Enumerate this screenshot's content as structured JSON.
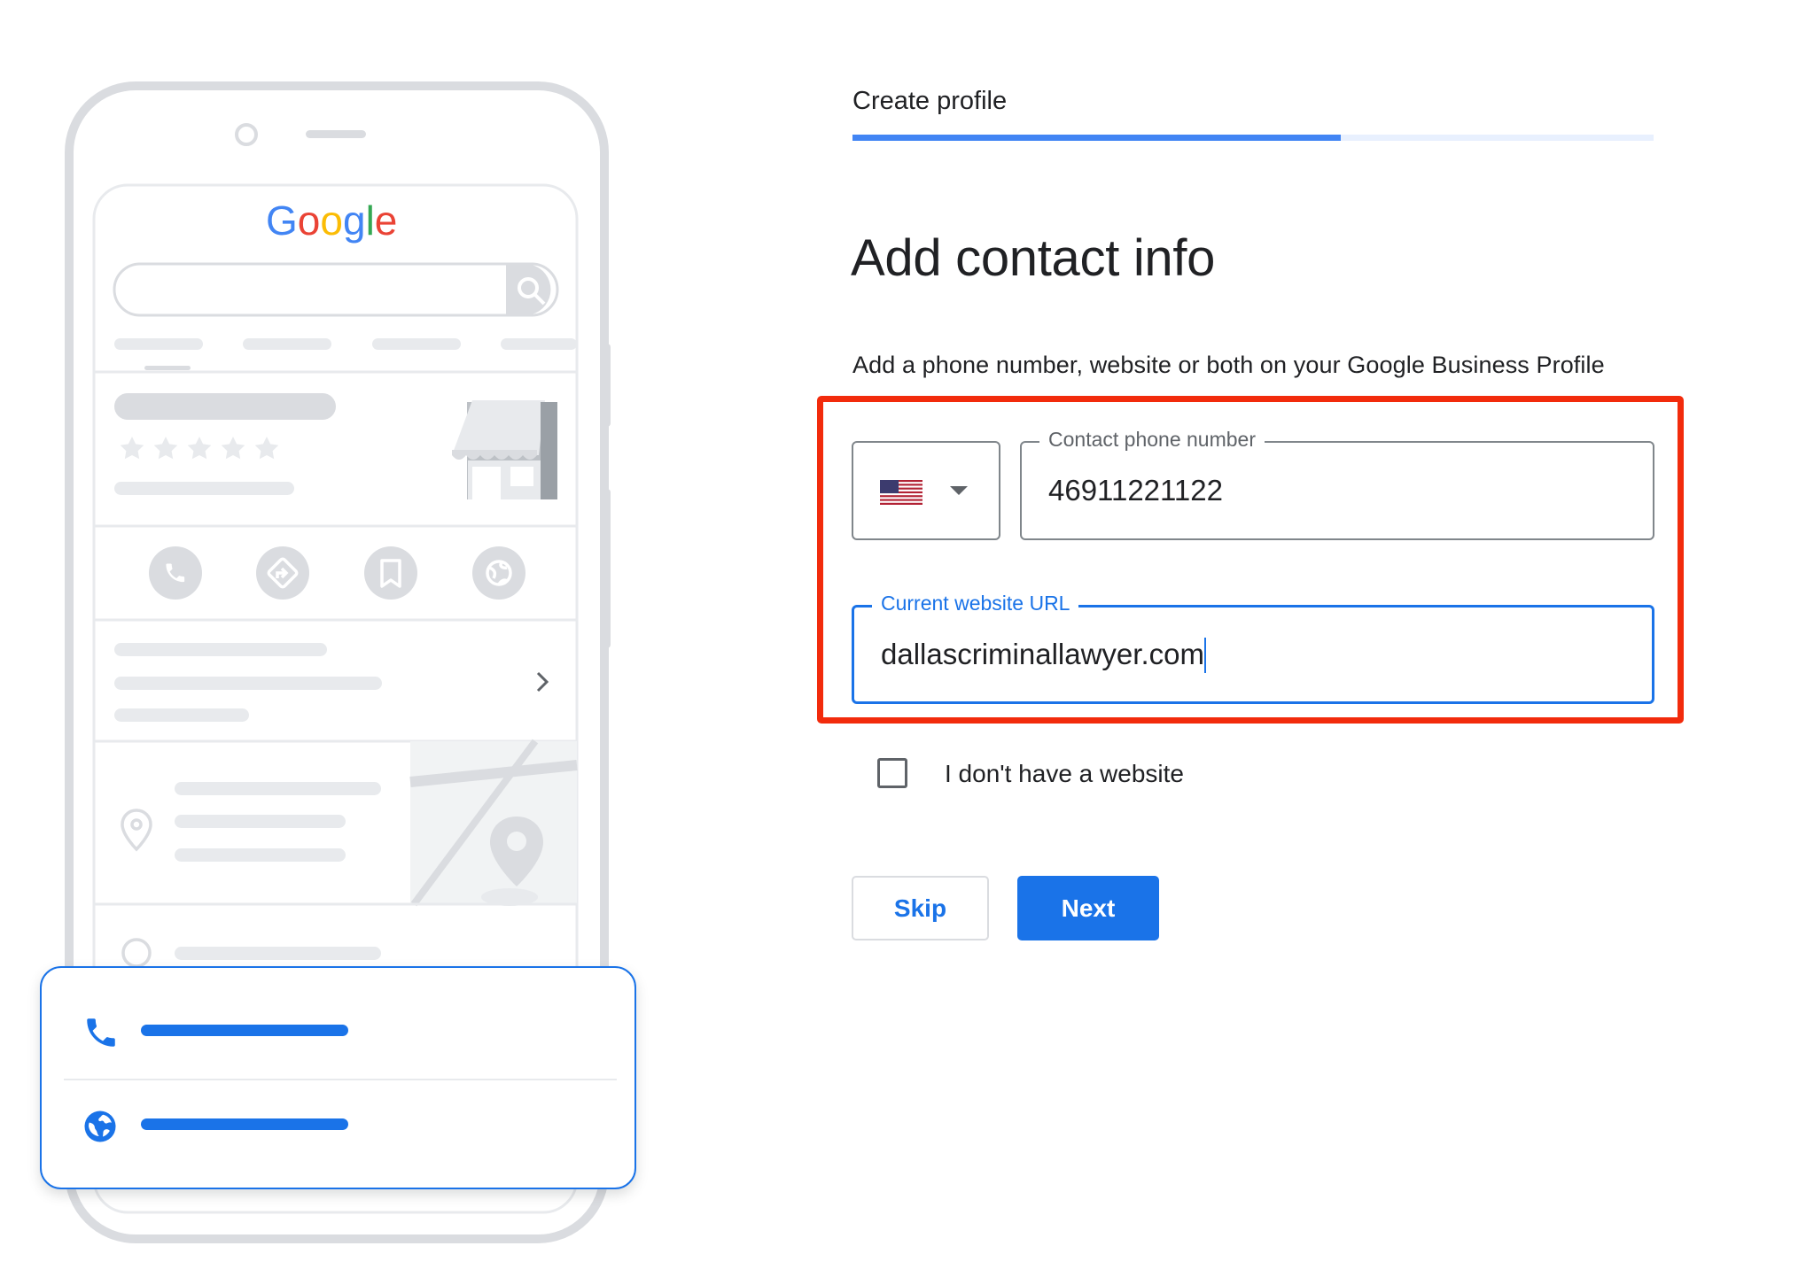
{
  "illustration": {
    "brand_logo_text": "Google",
    "brand_logo_colors": [
      "#4285F4",
      "#EA4335",
      "#FBBC05",
      "#4285F4",
      "#34A853",
      "#EA4335"
    ],
    "card_icons": [
      "phone-icon",
      "globe-icon"
    ]
  },
  "progress": {
    "step_label": "Create profile",
    "fraction_complete": 0.61,
    "fill_color": "#4285F4",
    "track_color": "#E8F0FE"
  },
  "form": {
    "title": "Add contact info",
    "subtitle": "Add a phone number, website or both on your Google Business Profile",
    "country_select": {
      "selected_flag": "us-flag-icon"
    },
    "phone": {
      "label": "Contact phone number",
      "value": "46911221122"
    },
    "website": {
      "label": "Current website URL",
      "value": "dallascriminallawyer.com"
    },
    "no_website_checkbox": {
      "label": "I don't have a website",
      "checked": false
    },
    "highlight_color": "#F22B0C"
  },
  "buttons": {
    "skip": "Skip",
    "next": "Next"
  },
  "colors": {
    "accent": "#1A73E8",
    "text": "#202124",
    "muted": "#5F6368"
  }
}
